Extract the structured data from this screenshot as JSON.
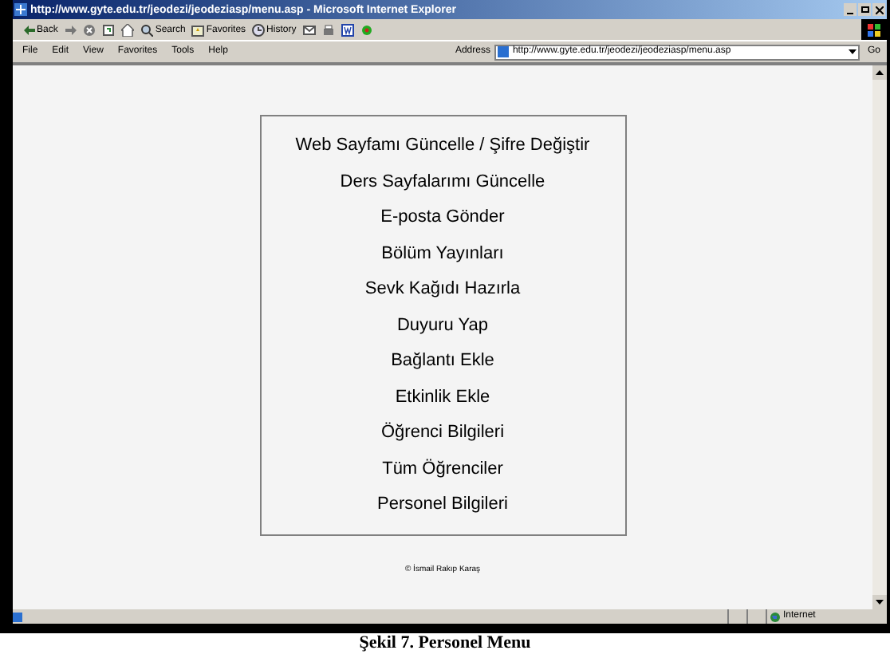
{
  "window": {
    "title": "http://www.gyte.edu.tr/jeodezi/jeodeziasp/menu.asp - Microsoft Internet Explorer"
  },
  "toolbar": [
    {
      "kind": "back",
      "label": "Back"
    },
    {
      "kind": "forward"
    },
    {
      "kind": "stop"
    },
    {
      "kind": "refresh"
    },
    {
      "kind": "home"
    },
    {
      "kind": "search",
      "label": "Search"
    },
    {
      "kind": "favorites",
      "label": "Favorites"
    },
    {
      "kind": "history",
      "label": "History"
    },
    {
      "kind": "mail"
    },
    {
      "kind": "print"
    },
    {
      "kind": "edit"
    },
    {
      "kind": "discuss"
    }
  ],
  "menu_bar": [
    "File",
    "Edit",
    "View",
    "Favorites",
    "Tools",
    "Help"
  ],
  "address": {
    "label": "Address",
    "value": "http://www.gyte.edu.tr/jeodezi/jeodeziasp/menu.asp",
    "go": "Go"
  },
  "menu_items": [
    "Web Sayfamı Güncelle / Şifre Değiştir",
    "Ders Sayfalarımı Güncelle",
    "E-posta Gönder",
    "Bölüm Yayınları",
    "Sevk Kağıdı Hazırla",
    "Duyuru Yap",
    "Bağlantı Ekle",
    "Etkinlik Ekle",
    "Öğrenci Bilgileri",
    "Tüm Öğrenciler",
    "Personel Bilgileri"
  ],
  "footer": "© İsmail Rakıp Karaş",
  "status_bar": {
    "zone": "Internet"
  },
  "caption": "Şekil 7. Personel Menu"
}
